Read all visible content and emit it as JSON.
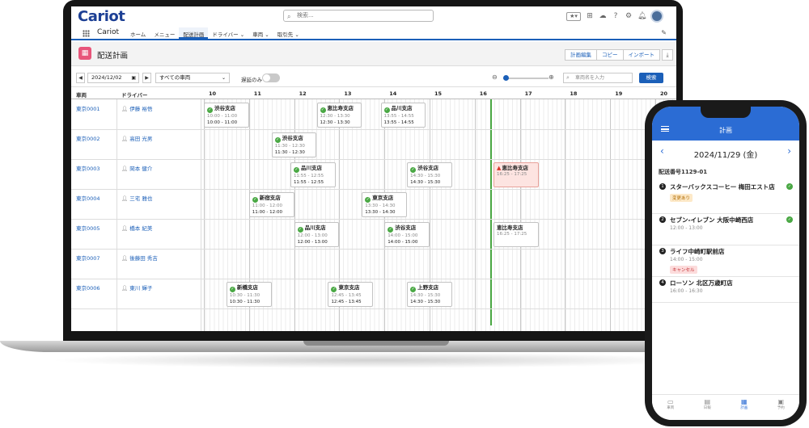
{
  "app": {
    "logo": "Cariot",
    "app_name": "Cariot",
    "search_placeholder": "検索...",
    "nav": [
      "ホーム",
      "メニュー",
      "配送計画",
      "ドライバー",
      "車両",
      "取引先"
    ],
    "page_title": "配送計画",
    "buttons": [
      "計画編集",
      "コピー",
      "インポート"
    ],
    "toolbar": {
      "date": "2024/12/02",
      "vehicle_filter": "すべての車両",
      "delay_only": "遅延のみ",
      "vehicle_search_placeholder": "車両名を入力",
      "search_button": "検索"
    },
    "columns": {
      "vehicle": "車両",
      "driver": "ドライバー"
    },
    "hours": [
      "10",
      "11",
      "12",
      "13",
      "14",
      "15",
      "16",
      "17",
      "18",
      "19",
      "20"
    ],
    "rows": [
      {
        "vehicle": "東京0001",
        "driver": "伊藤 裕悟"
      },
      {
        "vehicle": "東京0002",
        "driver": "高田 光男"
      },
      {
        "vehicle": "東京0003",
        "driver": "岡本 健介"
      },
      {
        "vehicle": "東京0004",
        "driver": "三宅 雅也"
      },
      {
        "vehicle": "東京0005",
        "driver": "橋本 紀美"
      },
      {
        "vehicle": "東京0007",
        "driver": "後藤田 秀吉"
      },
      {
        "vehicle": "東京0006",
        "driver": "東川 輝子"
      }
    ],
    "cards": [
      {
        "row": 0,
        "name": "渋谷支店",
        "plan": "10:00 - 11:00",
        "actual": "10:00 - 11:00",
        "status": "ok"
      },
      {
        "row": 0,
        "name": "恵比寿支店",
        "plan": "12:30 - 13:30",
        "actual": "12:30 - 13:30",
        "status": "ok"
      },
      {
        "row": 0,
        "name": "品川支店",
        "plan": "13:55 - 14:55",
        "actual": "13:55 - 14:55",
        "status": "ok"
      },
      {
        "row": 1,
        "name": "渋谷支店",
        "plan": "11:30 - 12:30",
        "actual": "11:30 - 12:30",
        "status": "ok"
      },
      {
        "row": 2,
        "name": "品川支店",
        "plan": "11:55 - 12:55",
        "actual": "11:55 - 12:55",
        "status": "ok"
      },
      {
        "row": 2,
        "name": "渋谷支店",
        "plan": "14:30 - 15:30",
        "actual": "14:30 - 15:30",
        "status": "ok"
      },
      {
        "row": 2,
        "name": "恵比寿支店",
        "plan": "16:25 - 17:25",
        "actual": "",
        "status": "alert"
      },
      {
        "row": 3,
        "name": "新宿支店",
        "plan": "11:00 - 12:00",
        "actual": "11:00 - 12:00",
        "status": "ok"
      },
      {
        "row": 3,
        "name": "東京支店",
        "plan": "13:30 - 14:30",
        "actual": "13:30 - 14:30",
        "status": "ok"
      },
      {
        "row": 4,
        "name": "品川支店",
        "plan": "12:00 - 13:00",
        "actual": "12:00 - 13:00",
        "status": "ok"
      },
      {
        "row": 4,
        "name": "渋谷支店",
        "plan": "14:00 - 15:00",
        "actual": "14:00 - 15:00",
        "status": "ok"
      },
      {
        "row": 4,
        "name": "恵比寿支店",
        "plan": "16:25 - 17:25",
        "actual": "",
        "status": "none"
      },
      {
        "row": 6,
        "name": "新橋支店",
        "plan": "10:30 - 11:30",
        "actual": "10:30 - 11:30",
        "status": "ok"
      },
      {
        "row": 6,
        "name": "東京支店",
        "plan": "12:45 - 13:45",
        "actual": "12:45 - 13:45",
        "status": "ok"
      },
      {
        "row": 6,
        "name": "上野支店",
        "plan": "14:30 - 15:30",
        "actual": "14:30 - 15:30",
        "status": "ok"
      }
    ]
  },
  "phone": {
    "title": "計画",
    "date": "2024/11/29 (金)",
    "delivery_no": "配送番号1129-01",
    "stops": [
      {
        "num": "1",
        "name": "スターバックスコーヒー 梅田エスト店",
        "time": "",
        "badge": "変更あり",
        "badge_color": "orange",
        "done": true
      },
      {
        "num": "2",
        "name": "セブン-イレブン 大阪中崎西店",
        "time": "12:00 - 13:00",
        "badge": "",
        "badge_color": "",
        "done": true
      },
      {
        "num": "3",
        "name": "ライフ中崎町駅前店",
        "time": "14:00 - 15:00",
        "badge": "キャンセル",
        "badge_color": "red",
        "done": false
      },
      {
        "num": "4",
        "name": "ローソン 北区万歳町店",
        "time": "16:00 - 16:30",
        "badge": "",
        "badge_color": "",
        "done": false
      }
    ],
    "tabs": [
      "車両",
      "日報",
      "計画",
      "予約"
    ]
  },
  "colors": {
    "brand": "#1c3f94",
    "accent": "#1b5fb8",
    "ok": "#4aa844",
    "alert_bg": "#fde4e1",
    "phone_header": "#2b6cd4"
  }
}
